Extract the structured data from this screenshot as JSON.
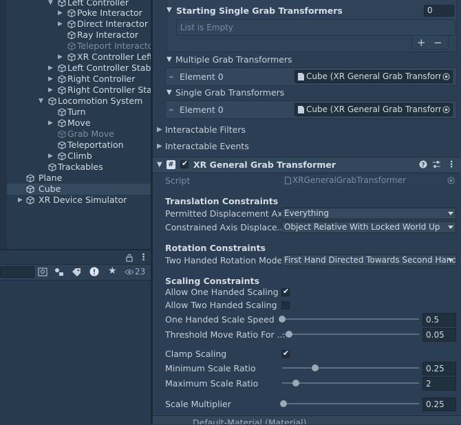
{
  "hierarchy": {
    "items": [
      {
        "label": "Left Controller",
        "state": "normal"
      },
      {
        "label": "Poke Interactor",
        "state": "normal"
      },
      {
        "label": "Direct Interactor",
        "state": "normal"
      },
      {
        "label": "Ray Interactor",
        "state": "normal"
      },
      {
        "label": "Teleport Interactor",
        "state": "disabled"
      },
      {
        "label": "XR Controller Left(C",
        "state": "normal"
      },
      {
        "label": "Left Controller Stabiliz",
        "state": "normal"
      },
      {
        "label": "Right Controller",
        "state": "normal"
      },
      {
        "label": "Right Controller Stabi",
        "state": "normal"
      },
      {
        "label": "Locomotion System",
        "state": "normal"
      },
      {
        "label": "Turn",
        "state": "normal"
      },
      {
        "label": "Move",
        "state": "normal"
      },
      {
        "label": "Grab Move",
        "state": "disabled"
      },
      {
        "label": "Teleportation",
        "state": "normal"
      },
      {
        "label": "Climb",
        "state": "normal"
      },
      {
        "label": "Trackables",
        "state": "normal"
      },
      {
        "label": "Plane",
        "state": "normal"
      },
      {
        "label": "Cube",
        "state": "selected"
      },
      {
        "label": "XR Device Simulator",
        "state": "normal"
      }
    ]
  },
  "project_toolbar": {
    "visible_count": "23"
  },
  "inspector": {
    "starting_single": {
      "title": "Starting Single Grab Transformers",
      "count": "0",
      "empty_text": "List is Empty",
      "add_label": "+",
      "remove_label": "−"
    },
    "multiple": {
      "title": "Multiple Grab Transformers",
      "element_label": "Element 0",
      "value": "Cube (XR General Grab Transformer)"
    },
    "single": {
      "title": "Single Grab Transformers",
      "element_label": "Element 0",
      "value": "Cube (XR General Grab Transformer)"
    },
    "interactable_filters": "Interactable Filters",
    "interactable_events": "Interactable Events",
    "component": {
      "title": "XR General Grab Transformer",
      "enabled": true,
      "script_label": "Script",
      "script_value": "XRGeneralGrabTransformer"
    },
    "translation": {
      "header": "Translation Constraints",
      "permitted_label": "Permitted Displacement Ax...",
      "permitted_value": "Everything",
      "constrained_label": "Constrained Axis Displace...",
      "constrained_value": "Object Relative With Locked World Up"
    },
    "rotation": {
      "header": "Rotation Constraints",
      "two_handed_label": "Two Handed Rotation Mode",
      "two_handed_value": "First Hand Directed Towards Second Hand"
    },
    "scaling": {
      "header": "Scaling Constraints",
      "allow_one_label": "Allow One Handed Scaling",
      "allow_one": true,
      "allow_two_label": "Allow Two Handed Scaling",
      "allow_two": false,
      "one_speed_label": "One Handed Scale Speed",
      "one_speed_value": "0.5",
      "one_speed_fraction": 0.0,
      "threshold_label": "Threshold Move Ratio For ...",
      "threshold_value": "0.05",
      "threshold_fraction": 0.05,
      "clamp_label": "Clamp Scaling",
      "clamp": true,
      "min_label": "Minimum Scale Ratio",
      "min_value": "0.25",
      "min_fraction": 0.24,
      "max_label": "Maximum Scale Ratio",
      "max_value": "2",
      "max_fraction": 0.1,
      "multiplier_label": "Scale Multiplier",
      "multiplier_value": "0.25",
      "multiplier_fraction": 0.01
    },
    "next_component": "Default-Material (Material)"
  }
}
